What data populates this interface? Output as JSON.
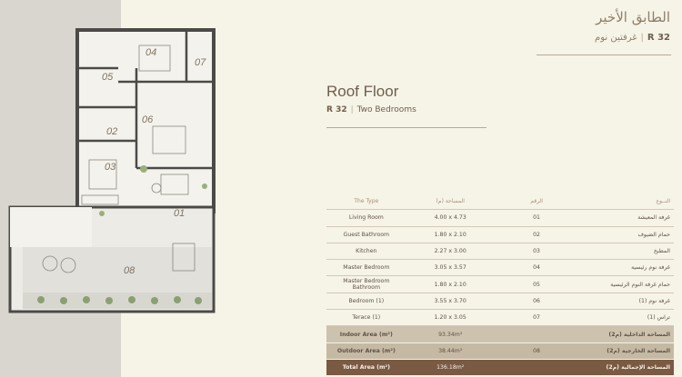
{
  "header_ar": {
    "title": "الطابق الأخير",
    "code": "R 32",
    "subtitle": "غرفتين نوم"
  },
  "header_en": {
    "title": "Roof Floor",
    "code": "R 32",
    "subtitle": "Two Bedrooms"
  },
  "floorplan": {
    "room_numbers": [
      "04",
      "07",
      "05",
      "06",
      "02",
      "03",
      "01",
      "08"
    ]
  },
  "table": {
    "headers": {
      "type": "The Type",
      "area": "المساحة (م)",
      "number": "الرقم",
      "type_ar": "النــوع"
    },
    "rows": [
      {
        "type": "Living Room",
        "area": "4.00 x 4.73",
        "number": "01",
        "type_ar": "غرفة المعيشة"
      },
      {
        "type": "Guest Bathroom",
        "area": "1.80 x 2.10",
        "number": "02",
        "type_ar": "حمام الضيوف"
      },
      {
        "type": "Kitchen",
        "area": "2.27 x 3.00",
        "number": "03",
        "type_ar": "المطبخ"
      },
      {
        "type": "Master Bedroom",
        "area": "3.05 x 3.57",
        "number": "04",
        "type_ar": "غرفة نوم رئيسية"
      },
      {
        "type": "Master Bedroom Bathroom",
        "area": "1.80 x 2.10",
        "number": "05",
        "type_ar": "حمام غرفة النوم الرئيسية"
      },
      {
        "type": "Bedroom (1)",
        "area": "3.55 x 3.70",
        "number": "06",
        "type_ar": "غرفة نوم (1)"
      },
      {
        "type": "Terace (1)",
        "area": "1.20 x 3.05",
        "number": "07",
        "type_ar": "تراس (1)"
      }
    ],
    "summary": [
      {
        "label": "Indoor Area (m²)",
        "value": "93.34m²",
        "number": "",
        "label_ar": "المساحة الداخلية (م2)"
      },
      {
        "label": "Outdoor Area (m²)",
        "value": "38.44m²",
        "number": "08",
        "label_ar": "المساحة الخارجية (م2)"
      },
      {
        "label": "Total Area (m²)",
        "value": "136.18m²",
        "number": "",
        "label_ar": "المساحة الإجمالية (م2)"
      }
    ]
  }
}
